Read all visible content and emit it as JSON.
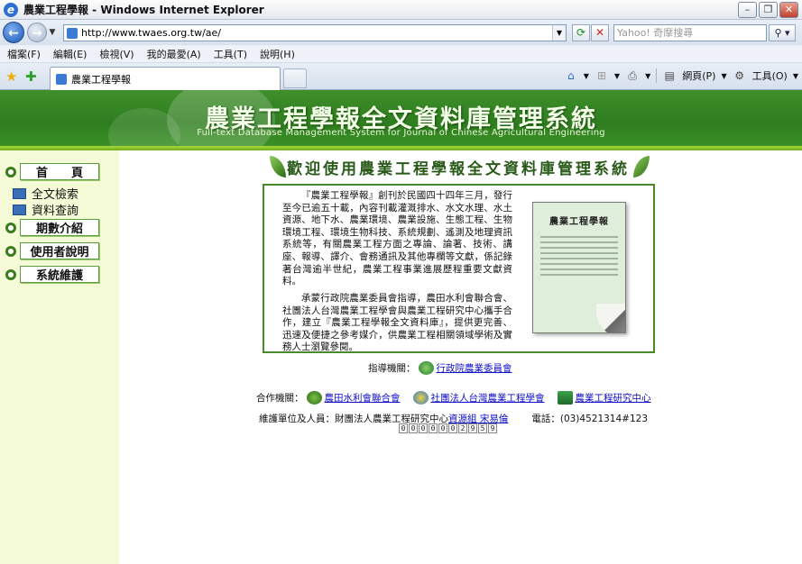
{
  "window": {
    "title": "農業工程學報 - Windows Internet Explorer"
  },
  "address": {
    "url": "http://www.twaes.org.tw/ae/",
    "search_placeholder": "Yahoo! 奇摩搜尋"
  },
  "menu": [
    "檔案(F)",
    "編輯(E)",
    "檢視(V)",
    "我的最愛(A)",
    "工具(T)",
    "說明(H)"
  ],
  "tab": {
    "title": "農業工程學報"
  },
  "commandbar": {
    "page": "網頁(P)",
    "tools": "工具(O)"
  },
  "banner": {
    "title": "農業工程學報全文資料庫管理系統",
    "subtitle": "Full-text Database Management System for Journal of Chinese Agricultural Engineering"
  },
  "sidebar": {
    "home": "首　　頁",
    "fulltext_search": "全文檢索",
    "data_query": "資料查詢",
    "issues": "期數介紹",
    "user_guide": "使用者說明",
    "maintenance": "系統維護"
  },
  "main": {
    "headline": "歡迎使用農業工程學報全文資料庫管理系統",
    "para1": "『農業工程學報』創刊於民國四十四年三月，發行至今已逾五十載，內容刊載灌溉排水、水文水理、水土資源、地下水、農業環境、農業設施、生態工程、生物環境工程、環境生物科技、系統規劃、遙測及地理資訊系統等，有關農業工程方面之專論、論著、技術、講座、報導、譯介、會務通訊及其他專欄等文獻，係記錄著台灣逾半世紀，農業工程事業進展歷程重要文獻資料。",
    "para2": "承蒙行政院農業委員會指導，農田水利會聯合會、社團法人台灣農業工程學會與農業工程研究中心攜手合作，建立『農業工程學報全文資料庫』，提供更完善、迅速及便捷之參考媒介，供農業工程相關領域學術及實務人士瀏覽參閱。",
    "cover_title": "農業工程學報",
    "guidance_label": "指導機關：",
    "guidance_org": "行政院農業委員會",
    "partner_label": "合作機關：",
    "partner1": "農田水利會聯合會",
    "partner2": "社團法人台灣農業工程學會",
    "partner3": "農業工程研究中心",
    "maintainer_label": "維護單位及人員：財團法人農業工程研究中心",
    "maintainer_link": "資源組 宋易倫",
    "phone": "電話：(03)4521314#123",
    "counter": [
      "0",
      "0",
      "0",
      "0",
      "0",
      "0",
      "2",
      "9",
      "5",
      "9"
    ]
  },
  "colors": {
    "banner_green": "#2e7d1f",
    "sidebar_bg": "#f4fbd6",
    "link": "#1010c8"
  }
}
